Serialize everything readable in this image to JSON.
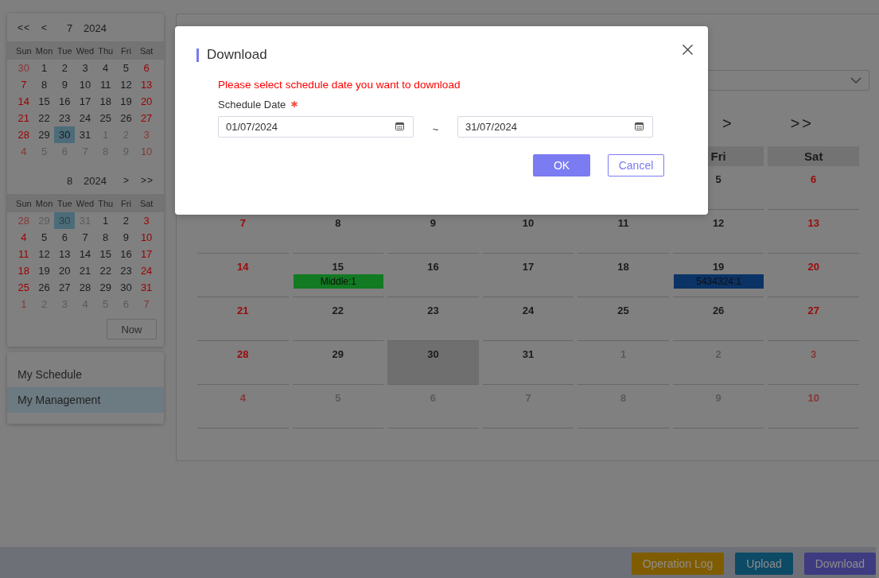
{
  "date_picker": {
    "months": [
      {
        "nav": [
          {
            "kind": "prev_year",
            "label": "<<"
          },
          {
            "kind": "prev_month",
            "label": "<"
          }
        ],
        "month": "7",
        "year": "2024",
        "weekdays": [
          "Sun",
          "Mon",
          "Tue",
          "Wed",
          "Thu",
          "Fri",
          "Sat"
        ],
        "weeks": [
          [
            {
              "day": "30",
              "outside": true,
              "selected": false
            },
            {
              "day": "1",
              "outside": false,
              "selected": false
            },
            {
              "day": "2",
              "outside": false,
              "selected": false
            },
            {
              "day": "3",
              "outside": false,
              "selected": false
            },
            {
              "day": "4",
              "outside": false,
              "selected": false
            },
            {
              "day": "5",
              "outside": false,
              "selected": false
            },
            {
              "day": "6",
              "outside": false,
              "selected": false
            }
          ],
          [
            {
              "day": "7",
              "outside": false,
              "selected": false
            },
            {
              "day": "8",
              "outside": false,
              "selected": false
            },
            {
              "day": "9",
              "outside": false,
              "selected": false
            },
            {
              "day": "10",
              "outside": false,
              "selected": false
            },
            {
              "day": "11",
              "outside": false,
              "selected": false
            },
            {
              "day": "12",
              "outside": false,
              "selected": false
            },
            {
              "day": "13",
              "outside": false,
              "selected": false
            }
          ],
          [
            {
              "day": "14",
              "outside": false,
              "selected": false
            },
            {
              "day": "15",
              "outside": false,
              "selected": false
            },
            {
              "day": "16",
              "outside": false,
              "selected": false
            },
            {
              "day": "17",
              "outside": false,
              "selected": false
            },
            {
              "day": "18",
              "outside": false,
              "selected": false
            },
            {
              "day": "19",
              "outside": false,
              "selected": false
            },
            {
              "day": "20",
              "outside": false,
              "selected": false
            }
          ],
          [
            {
              "day": "21",
              "outside": false,
              "selected": false
            },
            {
              "day": "22",
              "outside": false,
              "selected": false
            },
            {
              "day": "23",
              "outside": false,
              "selected": false
            },
            {
              "day": "24",
              "outside": false,
              "selected": false
            },
            {
              "day": "25",
              "outside": false,
              "selected": false
            },
            {
              "day": "26",
              "outside": false,
              "selected": false
            },
            {
              "day": "27",
              "outside": false,
              "selected": false
            }
          ],
          [
            {
              "day": "28",
              "outside": false,
              "selected": false
            },
            {
              "day": "29",
              "outside": false,
              "selected": false
            },
            {
              "day": "30",
              "outside": false,
              "selected": true
            },
            {
              "day": "31",
              "outside": false,
              "selected": false
            },
            {
              "day": "1",
              "outside": true,
              "selected": false
            },
            {
              "day": "2",
              "outside": true,
              "selected": false
            },
            {
              "day": "3",
              "outside": true,
              "selected": false
            }
          ],
          [
            {
              "day": "4",
              "outside": true,
              "selected": false
            },
            {
              "day": "5",
              "outside": true,
              "selected": false
            },
            {
              "day": "6",
              "outside": true,
              "selected": false
            },
            {
              "day": "7",
              "outside": true,
              "selected": false
            },
            {
              "day": "8",
              "outside": true,
              "selected": false
            },
            {
              "day": "9",
              "outside": true,
              "selected": false
            },
            {
              "day": "10",
              "outside": true,
              "selected": false
            }
          ]
        ]
      },
      {
        "nav": [
          {
            "kind": "next_month",
            "label": ">"
          },
          {
            "kind": "next_year",
            "label": ">>"
          }
        ],
        "month": "8",
        "year": "2024",
        "weekdays": [
          "Sun",
          "Mon",
          "Tue",
          "Wed",
          "Thu",
          "Fri",
          "Sat"
        ],
        "weeks": [
          [
            {
              "day": "28",
              "outside": true,
              "selected": false
            },
            {
              "day": "29",
              "outside": true,
              "selected": false
            },
            {
              "day": "30",
              "outside": true,
              "selected": true
            },
            {
              "day": "31",
              "outside": true,
              "selected": false
            },
            {
              "day": "1",
              "outside": false,
              "selected": false
            },
            {
              "day": "2",
              "outside": false,
              "selected": false
            },
            {
              "day": "3",
              "outside": false,
              "selected": false
            }
          ],
          [
            {
              "day": "4",
              "outside": false,
              "selected": false
            },
            {
              "day": "5",
              "outside": false,
              "selected": false
            },
            {
              "day": "6",
              "outside": false,
              "selected": false
            },
            {
              "day": "7",
              "outside": false,
              "selected": false
            },
            {
              "day": "8",
              "outside": false,
              "selected": false
            },
            {
              "day": "9",
              "outside": false,
              "selected": false
            },
            {
              "day": "10",
              "outside": false,
              "selected": false
            }
          ],
          [
            {
              "day": "11",
              "outside": false,
              "selected": false
            },
            {
              "day": "12",
              "outside": false,
              "selected": false
            },
            {
              "day": "13",
              "outside": false,
              "selected": false
            },
            {
              "day": "14",
              "outside": false,
              "selected": false
            },
            {
              "day": "15",
              "outside": false,
              "selected": false
            },
            {
              "day": "16",
              "outside": false,
              "selected": false
            },
            {
              "day": "17",
              "outside": false,
              "selected": false
            }
          ],
          [
            {
              "day": "18",
              "outside": false,
              "selected": false
            },
            {
              "day": "19",
              "outside": false,
              "selected": false
            },
            {
              "day": "20",
              "outside": false,
              "selected": false
            },
            {
              "day": "21",
              "outside": false,
              "selected": false
            },
            {
              "day": "22",
              "outside": false,
              "selected": false
            },
            {
              "day": "23",
              "outside": false,
              "selected": false
            },
            {
              "day": "24",
              "outside": false,
              "selected": false
            }
          ],
          [
            {
              "day": "25",
              "outside": false,
              "selected": false
            },
            {
              "day": "26",
              "outside": false,
              "selected": false
            },
            {
              "day": "27",
              "outside": false,
              "selected": false
            },
            {
              "day": "28",
              "outside": false,
              "selected": false
            },
            {
              "day": "29",
              "outside": false,
              "selected": false
            },
            {
              "day": "30",
              "outside": false,
              "selected": false
            },
            {
              "day": "31",
              "outside": false,
              "selected": false
            }
          ],
          [
            {
              "day": "1",
              "outside": true,
              "selected": false
            },
            {
              "day": "2",
              "outside": true,
              "selected": false
            },
            {
              "day": "3",
              "outside": true,
              "selected": false
            },
            {
              "day": "4",
              "outside": true,
              "selected": false
            },
            {
              "day": "5",
              "outside": true,
              "selected": false
            },
            {
              "day": "6",
              "outside": true,
              "selected": false
            },
            {
              "day": "7",
              "outside": true,
              "selected": false
            }
          ]
        ]
      }
    ],
    "now_button": "Now"
  },
  "menu": {
    "items": [
      {
        "label": "My Schedule",
        "selected": false
      },
      {
        "label": "My Management",
        "selected": true
      }
    ]
  },
  "calendar": {
    "nav": [
      {
        "kind": "next_month",
        "label": ">"
      },
      {
        "kind": "next_year",
        "label": ">>"
      }
    ],
    "weekdays": [
      "Fri",
      "Sat"
    ],
    "weeks": [
      [
        {
          "day": "5",
          "outside": false,
          "today": false
        },
        {
          "day": "6",
          "outside": false,
          "today": false
        }
      ],
      [
        {
          "day": "7",
          "outside": false,
          "today": false
        },
        {
          "day": "8",
          "outside": false,
          "today": false
        },
        {
          "day": "9",
          "outside": false,
          "today": false
        },
        {
          "day": "10",
          "outside": false,
          "today": false
        },
        {
          "day": "11",
          "outside": false,
          "today": false
        },
        {
          "day": "12",
          "outside": false,
          "today": false
        },
        {
          "day": "13",
          "outside": false,
          "today": false
        }
      ],
      [
        {
          "day": "14",
          "outside": false,
          "today": false
        },
        {
          "day": "15",
          "outside": false,
          "today": false,
          "events": [
            {
              "label": "Middle:1",
              "color": "#117a22"
            }
          ]
        },
        {
          "day": "16",
          "outside": false,
          "today": false
        },
        {
          "day": "17",
          "outside": false,
          "today": false
        },
        {
          "day": "18",
          "outside": false,
          "today": false
        },
        {
          "day": "19",
          "outside": false,
          "today": false,
          "events": [
            {
              "label": "5434324:1",
              "color": "#0b3366"
            }
          ]
        },
        {
          "day": "20",
          "outside": false,
          "today": false
        }
      ],
      [
        {
          "day": "21",
          "outside": false,
          "today": false
        },
        {
          "day": "22",
          "outside": false,
          "today": false
        },
        {
          "day": "23",
          "outside": false,
          "today": false
        },
        {
          "day": "24",
          "outside": false,
          "today": false
        },
        {
          "day": "25",
          "outside": false,
          "today": false
        },
        {
          "day": "26",
          "outside": false,
          "today": false
        },
        {
          "day": "27",
          "outside": false,
          "today": false
        }
      ],
      [
        {
          "day": "28",
          "outside": false,
          "today": false
        },
        {
          "day": "29",
          "outside": false,
          "today": false
        },
        {
          "day": "30",
          "outside": false,
          "today": true
        },
        {
          "day": "31",
          "outside": false,
          "today": false
        },
        {
          "day": "1",
          "outside": true,
          "today": false
        },
        {
          "day": "2",
          "outside": true,
          "today": false
        },
        {
          "day": "3",
          "outside": true,
          "today": false
        }
      ],
      [
        {
          "day": "4",
          "outside": true,
          "today": false
        },
        {
          "day": "5",
          "outside": true,
          "today": false
        },
        {
          "day": "6",
          "outside": true,
          "today": false
        },
        {
          "day": "7",
          "outside": true,
          "today": false
        },
        {
          "day": "8",
          "outside": true,
          "today": false
        },
        {
          "day": "9",
          "outside": true,
          "today": false
        },
        {
          "day": "10",
          "outside": true,
          "today": false
        }
      ]
    ]
  },
  "dialog": {
    "title": "Download",
    "message": "Please select schedule date you want to download",
    "field_label": "Schedule Date",
    "required": true,
    "date_from": "01/07/2024",
    "separator": "~",
    "date_to": "31/07/2024",
    "buttons": [
      {
        "label": "OK",
        "kind": "primary"
      },
      {
        "label": "Cancel",
        "kind": "secondary"
      }
    ]
  },
  "footer": {
    "buttons": [
      {
        "label": "Operation Log",
        "color": "#805c00"
      },
      {
        "label": "Upload",
        "color": "#0d4a66"
      },
      {
        "label": "Download",
        "color": "#3f3b80"
      }
    ]
  }
}
